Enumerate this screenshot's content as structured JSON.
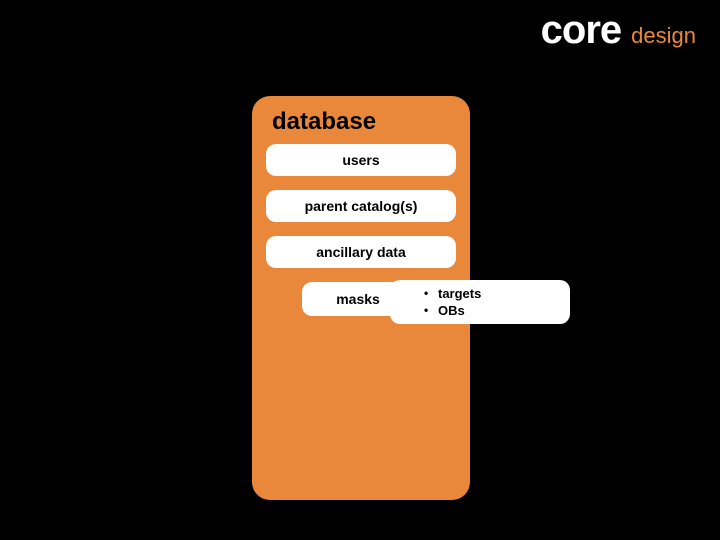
{
  "header": {
    "title": "core",
    "subtitle": "design"
  },
  "panel": {
    "title": "database",
    "items": [
      "users",
      "parent catalog(s)",
      "ancillary data"
    ],
    "masks_label": "masks"
  },
  "sub": {
    "items": [
      "targets",
      "OBs"
    ]
  }
}
